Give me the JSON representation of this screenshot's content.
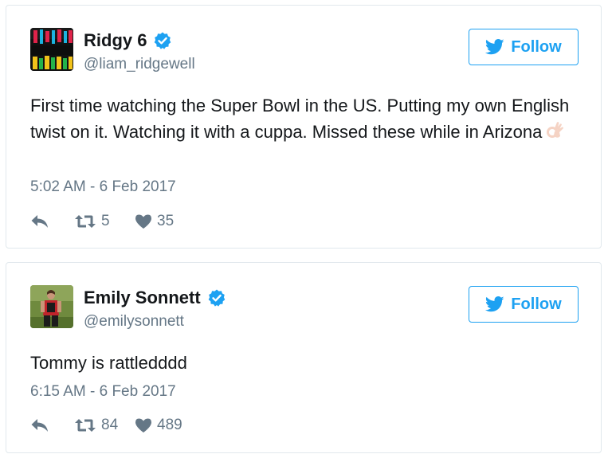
{
  "colors": {
    "accent": "#1da1f2",
    "verified": "#1da1f2",
    "text": "#14171a",
    "muted": "#657786",
    "border": "#e1e8ed"
  },
  "tweets": [
    {
      "display_name": "Ridgy 6",
      "handle": "@liam_ridgewell",
      "verified": true,
      "follow_label": "Follow",
      "text": "First time watching the Super Bowl in the US. Putting my own English twist on it. Watching it with a cuppa. Missed these while in Arizona",
      "emoji": "ok-hand-icon",
      "timestamp": "5:02 AM - 6 Feb 2017",
      "retweets": "5",
      "likes": "35"
    },
    {
      "display_name": "Emily Sonnett",
      "handle": "@emilysonnett",
      "verified": true,
      "follow_label": "Follow",
      "text": "Tommy is rattledddd",
      "timestamp": "6:15 AM - 6 Feb 2017",
      "retweets": "84",
      "likes": "489"
    }
  ]
}
